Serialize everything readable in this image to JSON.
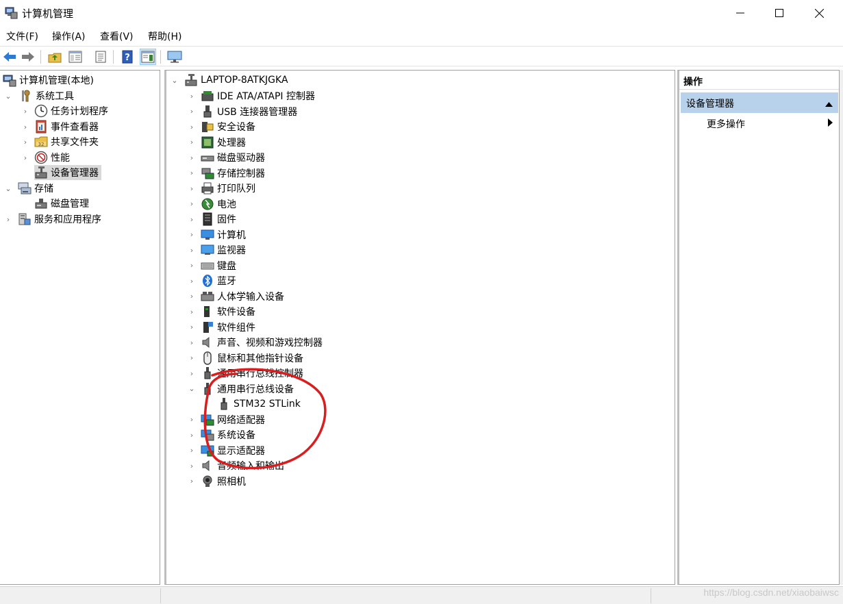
{
  "window": {
    "title": "计算机管理",
    "minimize_glyph": "—",
    "maximize_glyph": "☐",
    "close_glyph": "✕"
  },
  "menu": [
    "文件(F)",
    "操作(A)",
    "查看(V)",
    "帮助(H)"
  ],
  "toolbar": {
    "buttons": [
      "back-icon",
      "forward-icon",
      "up-folder-icon",
      "show-hide-tree-icon",
      "properties-icon",
      "help-icon",
      "show-action-pane-icon",
      "monitor-icon"
    ]
  },
  "left_tree": {
    "root": "计算机管理(本地)",
    "system_tools": "系统工具",
    "task_scheduler": "任务计划程序",
    "event_viewer": "事件查看器",
    "shared_folders": "共享文件夹",
    "performance": "性能",
    "device_manager": "设备管理器",
    "storage": "存储",
    "disk_management": "磁盘管理",
    "services_apps": "服务和应用程序"
  },
  "device_tree": {
    "computer": "LAPTOP-8ATKJGKA",
    "categories": [
      "IDE ATA/ATAPI 控制器",
      "USB 连接器管理器",
      "安全设备",
      "处理器",
      "磁盘驱动器",
      "存储控制器",
      "打印队列",
      "电池",
      "固件",
      "计算机",
      "监视器",
      "键盘",
      "蓝牙",
      "人体学输入设备",
      "软件设备",
      "软件组件",
      "声音、视频和游戏控制器",
      "鼠标和其他指针设备",
      "通用串行总线控制器",
      "通用串行总线设备",
      "STM32 STLink",
      "网络适配器",
      "系统设备",
      "显示适配器",
      "音频输入和输出",
      "照相机"
    ]
  },
  "actions": {
    "header": "操作",
    "group": "设备管理器",
    "more": "更多操作"
  },
  "watermark": "https://blog.csdn.net/xiaobaiwsc",
  "colors": {
    "selection": "#d9d9d9",
    "action_group": "#b7d2ea",
    "annotation": "#d81e1e"
  }
}
